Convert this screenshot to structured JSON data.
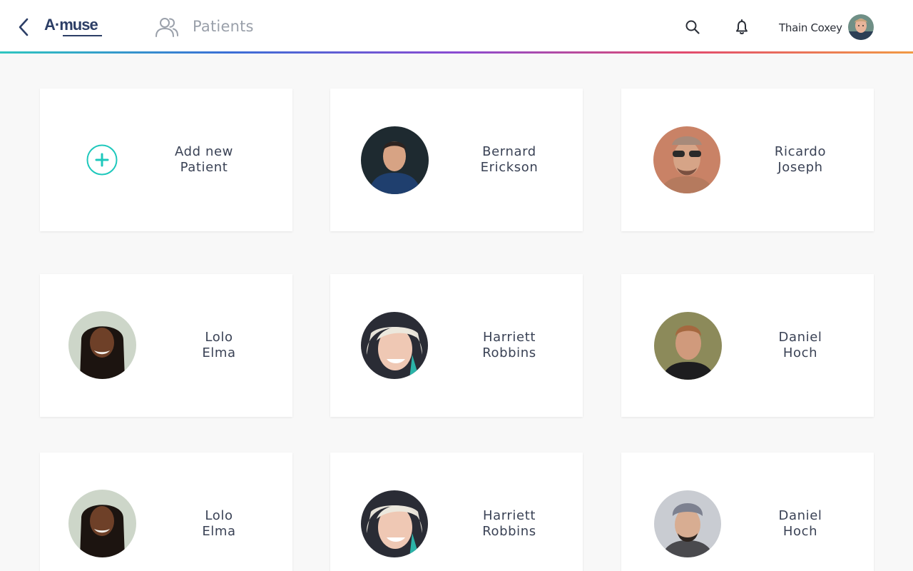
{
  "header": {
    "logo_text": "A·muse",
    "section_title": "Patients",
    "user_name": "Thain Coxey",
    "gradient_colors": [
      "#2fc6c0",
      "#3b6fd6",
      "#8a4bd2",
      "#e24b6e",
      "#f19a44"
    ]
  },
  "add_card": {
    "line1": "Add new",
    "line2": "Patient",
    "accent_color": "#1ec8bc"
  },
  "patients": [
    {
      "first": "Bernard",
      "last": "Erickson"
    },
    {
      "first": "Ricardo",
      "last": "Joseph"
    },
    {
      "first": "Lolo",
      "last": "Elma"
    },
    {
      "first": "Harriett",
      "last": "Robbins"
    },
    {
      "first": "Daniel",
      "last": "Hoch"
    },
    {
      "first": "Lolo",
      "last": "Elma"
    },
    {
      "first": "Harriett",
      "last": "Robbins"
    },
    {
      "first": "Daniel",
      "last": "Hoch"
    }
  ],
  "icons": {
    "back": "chevron-left-icon",
    "section": "users-icon",
    "search": "search-icon",
    "notifications": "bell-icon",
    "add": "plus-circle-icon"
  }
}
